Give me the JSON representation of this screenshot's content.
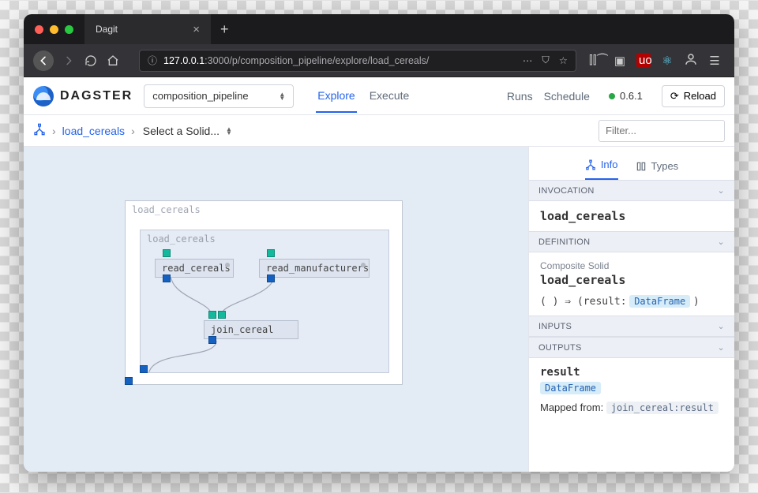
{
  "browser": {
    "tab_title": "Dagit",
    "url_host": "127.0.0.1",
    "url_port": ":3000",
    "url_path": "/p/composition_pipeline/explore/load_cereals/"
  },
  "brand": "DAGSTER",
  "pipeline_selector": "composition_pipeline",
  "app_tabs": {
    "explore": "Explore",
    "execute": "Execute"
  },
  "nav": {
    "runs": "Runs",
    "schedule": "Schedule"
  },
  "version": "0.6.1",
  "reload": "Reload",
  "breadcrumb": {
    "item": "load_cereals",
    "select_placeholder": "Select a Solid..."
  },
  "filter_placeholder": "Filter...",
  "dag": {
    "outer_label": "load_cereals",
    "inner_label": "load_cereals",
    "solids": {
      "read_cereals": "read_cereals",
      "read_manufacturers": "read_manufacturers",
      "join_cereal": "join_cereal"
    }
  },
  "panel": {
    "tab_info": "Info",
    "tab_types": "Types",
    "sections": {
      "invocation": "INVOCATION",
      "definition": "DEFINITION",
      "inputs": "INPUTS",
      "outputs": "OUTPUTS"
    },
    "invocation_name": "load_cereals",
    "definition_kind": "Composite Solid",
    "definition_name": "load_cereals",
    "sig_open": "( )  ⇒  (result:",
    "sig_type": "DataFrame",
    "sig_close": ")",
    "output_name": "result",
    "output_type": "DataFrame",
    "mapped_label": "Mapped from:",
    "mapped_value": "join_cereal:result"
  }
}
